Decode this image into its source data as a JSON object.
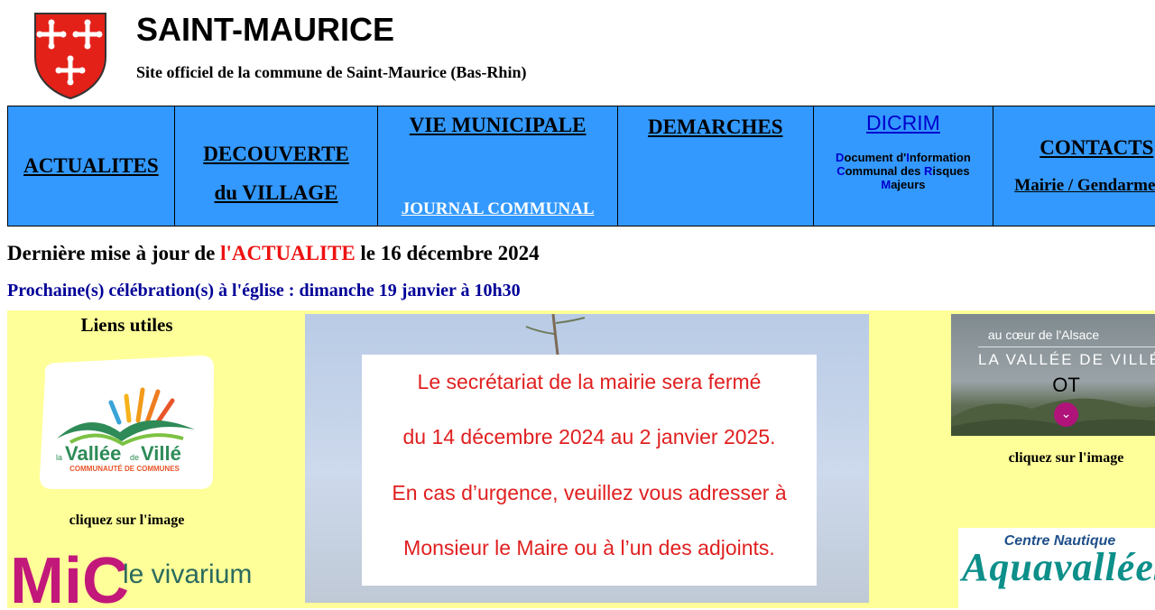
{
  "header": {
    "title": "SAINT-MAURICE",
    "subtitle": "Site officiel de la commune de Saint-Maurice (Bas-Rhin)"
  },
  "nav": {
    "actualites": "ACTUALITES",
    "decouverte_1": "DECOUVERTE",
    "decouverte_2": "du VILLAGE",
    "vie_municipale": "VIE MUNICIPALE",
    "journal": "JOURNAL COMMUNAL",
    "demarches": "DEMARCHES",
    "dicrim": "DICRIM",
    "dicrim_desc": {
      "l1a": "D",
      "l1b": "ocument d'",
      "l1c": "I",
      "l1d": "nformation",
      "l2a": "C",
      "l2b": "ommunal des ",
      "l2c": "R",
      "l2d": "isques",
      "l3a": "M",
      "l3b": "ajeurs"
    },
    "contacts": "CONTACTS",
    "mairie": "Mairie / Gendarmerie"
  },
  "update": {
    "prefix": "Dernière mise à jour de ",
    "accent": "l'ACTUALITE",
    "suffix": " le 16 décembre 2024"
  },
  "celebration": "Prochaine(s) célébration(s) à l'église : dimanche 19 janvier à 10h30",
  "sidebar_left": {
    "title": "Liens utiles",
    "vallee_logo": {
      "small_la": "la",
      "name1": "Vallée",
      "small_de": "de",
      "name2": "Villé",
      "sub": "COMMUNAUTÉ DE COMMUNES"
    },
    "click_label": "cliquez sur l'image",
    "mic_logo": {
      "mic": "MiC",
      "vivarium": "le vivarium"
    }
  },
  "notice": {
    "line1": "Le secrétariat de la mairie sera fermé",
    "line2": "du 14 décembre 2024 au 2 janvier 2025.",
    "line3": "En cas d’urgence, veuillez vous adresser à",
    "line4": "Monsieur le Maire ou à l’un des adjoints."
  },
  "sidebar_right": {
    "ot_banner": {
      "small": "au cœur de l'Alsace",
      "big": "LA VALLÉE DE VILLÉ",
      "ot": "OT",
      "chevron": "⌄"
    },
    "click_label": "cliquez sur l'image",
    "aqua": {
      "centre": "Centre Nautique",
      "name": "Aquavallées"
    }
  },
  "colors": {
    "nav_bg": "#3399ff",
    "content_bg": "#ffff99",
    "accent_red": "#ee1111",
    "celebration_blue": "#000099",
    "dicrim_blue": "#0000cc"
  }
}
